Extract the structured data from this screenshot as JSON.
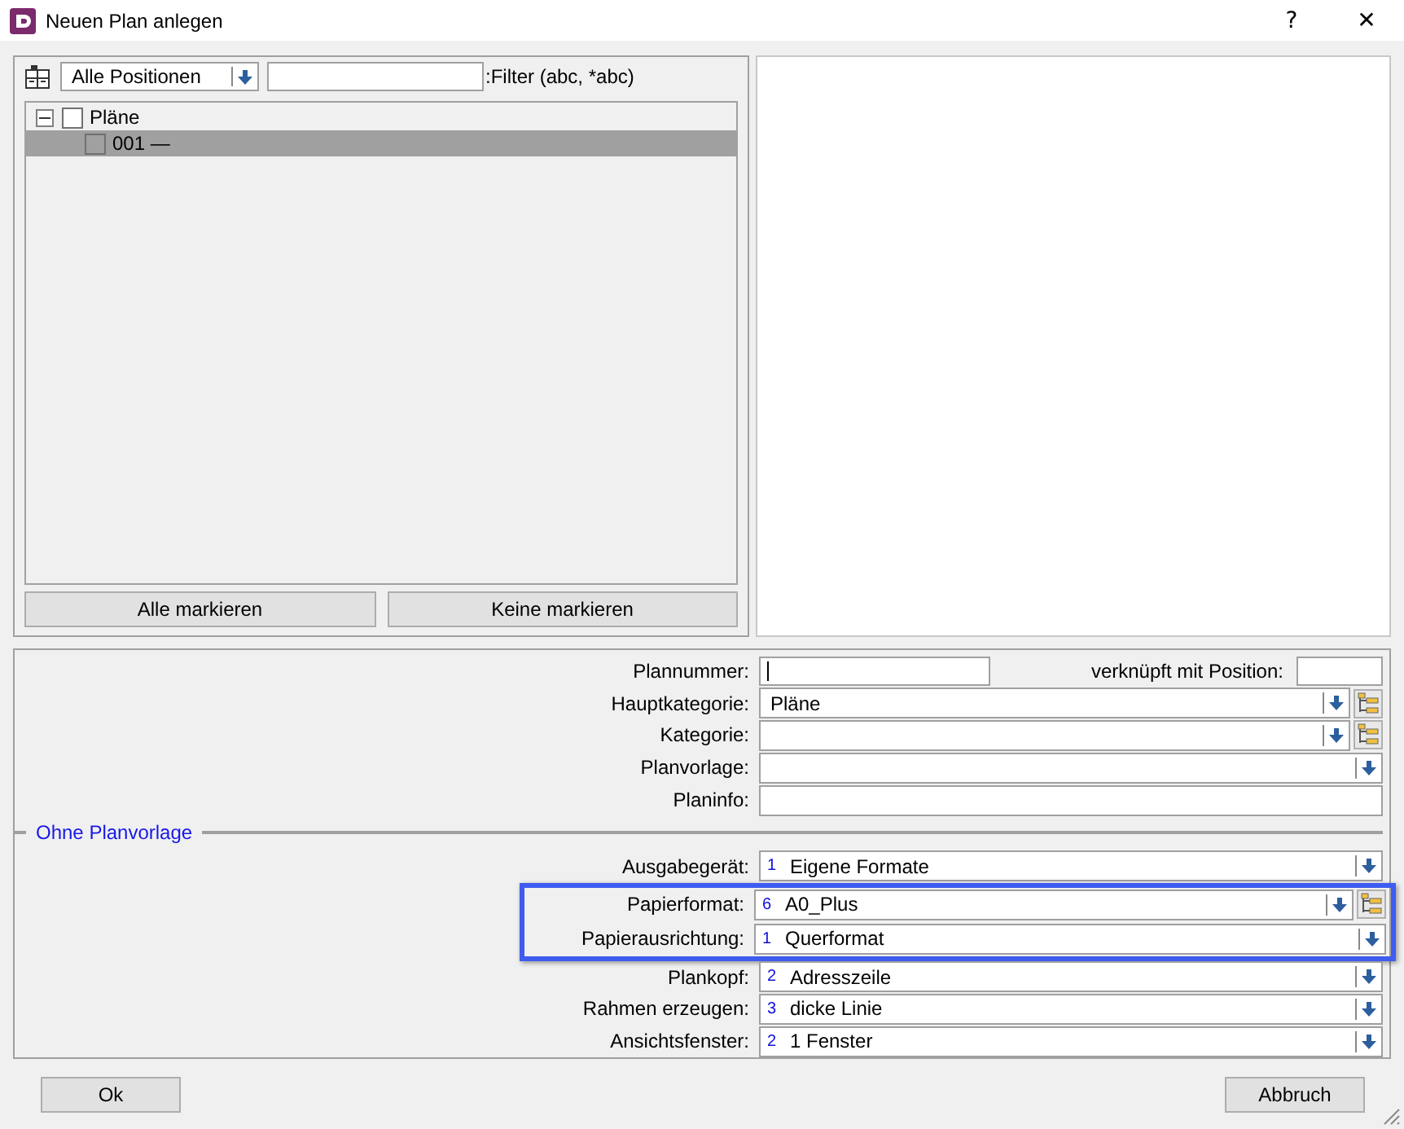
{
  "window": {
    "title": "Neuen Plan anlegen",
    "help": "?",
    "close": "✕"
  },
  "toolbar": {
    "scope": "Alle Positionen",
    "filter_label": ":Filter (abc, *abc)"
  },
  "tree": [
    {
      "label": "Pläne",
      "expanded": true,
      "checked": false,
      "selected": false,
      "children": [
        {
          "label": "001 —",
          "checked": false,
          "selected": true
        }
      ]
    }
  ],
  "list_buttons": [
    "Alle markieren",
    "Keine markieren"
  ],
  "fields": [
    {
      "kind": "number",
      "label": "Plannummer:",
      "focused": true,
      "link_label": "verknüpft mit Position:"
    },
    {
      "kind": "combo",
      "label": "Hauptkategorie:",
      "value": "Pläne",
      "tree_button": true
    },
    {
      "kind": "combo",
      "label": "Kategorie:",
      "tree_button": true
    },
    {
      "kind": "combo",
      "label": "Planvorlage:",
      "tree_button": false
    },
    {
      "kind": "text",
      "label": "Planinfo:"
    }
  ],
  "section": {
    "title": "Ohne Planvorlage"
  },
  "options": [
    {
      "label": "Ausgabegerät:",
      "index": "1",
      "value": "Eigene Formate",
      "tree_button": false,
      "highlighted": false
    },
    {
      "label": "Papierformat:",
      "index": "6",
      "value": "A0_Plus",
      "tree_button": true,
      "highlighted": true
    },
    {
      "label": "Papierausrichtung:",
      "index": "1",
      "value": "Querformat",
      "tree_button": false,
      "highlighted": true
    },
    {
      "label": "Plankopf:",
      "index": "2",
      "value": "Adresszeile",
      "tree_button": false,
      "highlighted": false
    },
    {
      "label": "Rahmen erzeugen:",
      "index": "3",
      "value": "dicke Linie",
      "tree_button": false,
      "highlighted": false
    },
    {
      "label": "Ansichtsfenster:",
      "index": "2",
      "value": "1 Fenster",
      "tree_button": false,
      "highlighted": false
    }
  ],
  "buttons": [
    "Ok",
    "Abbruch"
  ]
}
